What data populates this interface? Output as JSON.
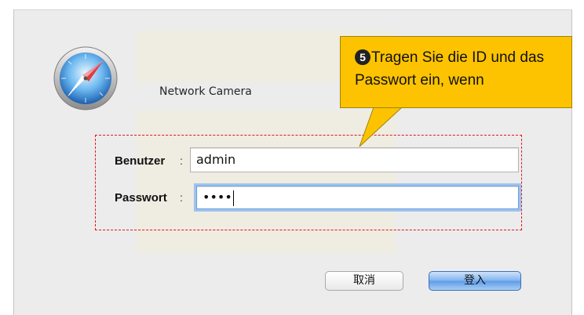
{
  "dialog": {
    "site_name": "Network Camera",
    "username_label": "Benutzer",
    "username_value": "admin",
    "password_label": "Passwort",
    "password_value": "••••",
    "label_colon": ":",
    "cancel_label": "取消",
    "login_label": "登入"
  },
  "annotation": {
    "step_number": "5",
    "text": "Tragen Sie die ID und das Passwort ein, wenn",
    "color": "#fdc300",
    "highlight_color": "#e0161d"
  },
  "icons": {
    "app_icon": "safari-compass-icon"
  }
}
